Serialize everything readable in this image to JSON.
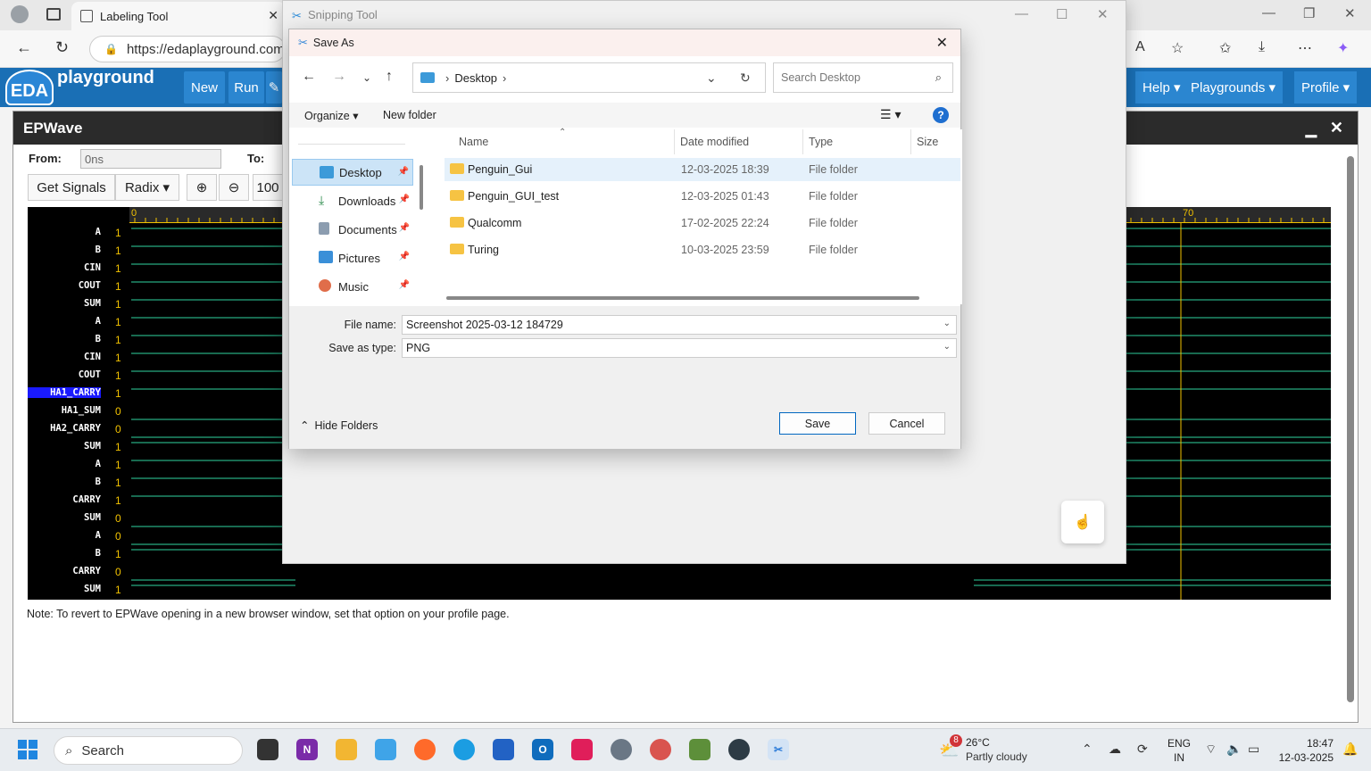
{
  "browser": {
    "tab_title": "Labeling Tool",
    "tab_close": "✕",
    "url": "https://edaplayground.com",
    "min": "—",
    "restore": "❐",
    "close": "✕"
  },
  "eda": {
    "logo": "EDA",
    "brand": "playground",
    "buttons": {
      "new": "New",
      "run": "Run"
    },
    "right_buttons": {
      "help": "Help ▾",
      "playgrounds": "Playgrounds ▾",
      "profile": "Profile ▾"
    }
  },
  "epwave": {
    "title": "EPWave",
    "from_label": "From:",
    "from_value": "0ns",
    "to_label": "To:",
    "get_signals": "Get Signals",
    "radix": "Radix ▾",
    "zoom_value": "100",
    "ruler_start": "0",
    "ruler_mid": "70",
    "ruler_right": "70",
    "note": "Note: To revert to EPWave opening in a new browser window, set that option on your profile page.",
    "signals": [
      {
        "name": "A",
        "value": "1"
      },
      {
        "name": "B",
        "value": "1"
      },
      {
        "name": "CIN",
        "value": "1"
      },
      {
        "name": "COUT",
        "value": "1"
      },
      {
        "name": "SUM",
        "value": "1"
      },
      {
        "name": "A",
        "value": "1"
      },
      {
        "name": "B",
        "value": "1"
      },
      {
        "name": "CIN",
        "value": "1"
      },
      {
        "name": "COUT",
        "value": "1"
      },
      {
        "name": "HA1_CARRY",
        "value": "1"
      },
      {
        "name": "HA1_SUM",
        "value": "0"
      },
      {
        "name": "HA2_CARRY",
        "value": "0"
      },
      {
        "name": "SUM",
        "value": "1"
      },
      {
        "name": "A",
        "value": "1"
      },
      {
        "name": "B",
        "value": "1"
      },
      {
        "name": "CARRY",
        "value": "1"
      },
      {
        "name": "SUM",
        "value": "0"
      },
      {
        "name": "A",
        "value": "0"
      },
      {
        "name": "B",
        "value": "1"
      },
      {
        "name": "CARRY",
        "value": "0"
      },
      {
        "name": "SUM",
        "value": "1"
      }
    ]
  },
  "snipping": {
    "title": "Snipping Tool"
  },
  "saveas": {
    "title": "Save As",
    "path_folder": "Desktop",
    "search_placeholder": "Search Desktop",
    "organize": "Organize ▾",
    "new_folder": "New folder",
    "help": "?",
    "nav_items": [
      {
        "label": "Desktop"
      },
      {
        "label": "Downloads"
      },
      {
        "label": "Documents"
      },
      {
        "label": "Pictures"
      },
      {
        "label": "Music"
      }
    ],
    "columns": {
      "name": "Name",
      "date": "Date modified",
      "type": "Type",
      "size": "Size"
    },
    "files": [
      {
        "name": "Penguin_Gui",
        "date": "12-03-2025 18:39",
        "type": "File folder"
      },
      {
        "name": "Penguin_GUI_test",
        "date": "12-03-2025 01:43",
        "type": "File folder"
      },
      {
        "name": "Qualcomm",
        "date": "17-02-2025 22:24",
        "type": "File folder"
      },
      {
        "name": "Turing",
        "date": "10-03-2025 23:59",
        "type": "File folder"
      }
    ],
    "file_name_label": "File name:",
    "file_name": "Screenshot 2025-03-12 184729",
    "save_type_label": "Save as type:",
    "save_type": "PNG",
    "hide_folders": "Hide Folders",
    "save": "Save",
    "cancel": "Cancel"
  },
  "taskbar": {
    "search": "Search",
    "weather_badge": "8",
    "temp": "26°C",
    "condition": "Partly cloudy",
    "lang1": "ENG",
    "lang2": "IN",
    "time": "18:47",
    "date": "12-03-2025"
  }
}
